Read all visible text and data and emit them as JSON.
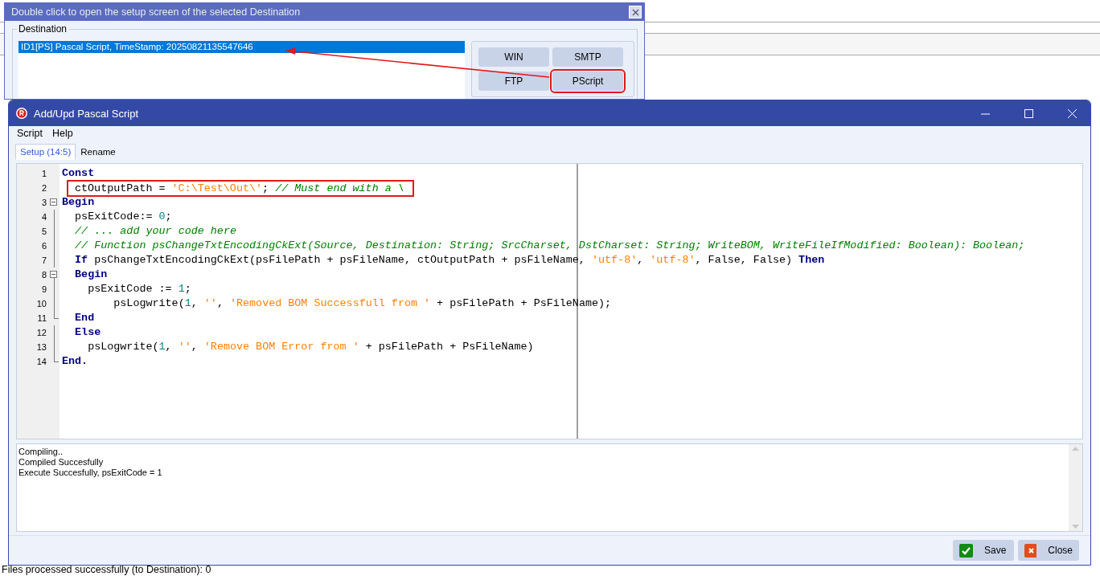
{
  "background": {
    "status_text": "Files processed successfully (to Destination): 0"
  },
  "destination_window": {
    "title": "Double click to open the setup screen of the selected Destination",
    "group_label": "Destination",
    "items": [
      {
        "text": "ID1[PS] Pascal Script, TimeStamp: 20250821135547646",
        "selected": true
      }
    ],
    "buttons": [
      {
        "label": "WIN",
        "highlighted": false
      },
      {
        "label": "SMTP",
        "highlighted": false
      },
      {
        "label": "FTP",
        "highlighted": false
      },
      {
        "label": "PScript",
        "highlighted": true
      }
    ]
  },
  "script_window": {
    "title": "Add/Upd Pascal Script",
    "menu": [
      "Script",
      "Help"
    ],
    "tabs": [
      {
        "label": "Setup (14:5)",
        "selected": true
      },
      {
        "label": "Rename",
        "selected": false
      }
    ],
    "code_lines": [
      {
        "number": "1",
        "kind": "plain",
        "highlighted": false,
        "tokens": [
          {
            "kind": "keyword",
            "text": "Const"
          }
        ]
      },
      {
        "number": "2",
        "kind": "plain",
        "highlighted": true,
        "tokens": [
          {
            "kind": "text",
            "text": "ctOutputPath = "
          },
          {
            "kind": "string",
            "text": "'C:\\Test\\Out\\'"
          },
          {
            "kind": "text",
            "text": "; "
          },
          {
            "kind": "comment",
            "text": "// Must end with a \\"
          }
        ]
      },
      {
        "number": "3",
        "kind": "opener",
        "highlighted": false,
        "tokens": [
          {
            "kind": "keyword",
            "text": "Begin"
          }
        ]
      },
      {
        "number": "4",
        "kind": "body",
        "highlighted": false,
        "tokens": [
          {
            "kind": "text",
            "text": "  psExitCode:= "
          },
          {
            "kind": "number",
            "text": "0"
          },
          {
            "kind": "text",
            "text": ";"
          }
        ]
      },
      {
        "number": "5",
        "kind": "body",
        "highlighted": false,
        "tokens": [
          {
            "kind": "comment",
            "text": "  // ... add your code here"
          }
        ]
      },
      {
        "number": "6",
        "kind": "body",
        "highlighted": false,
        "tokens": [
          {
            "kind": "comment",
            "text": "  // Function psChangeTxtEncodingCkExt(Source, Destination: String; SrcCharset, DstCharset: String; WriteBOM, WriteFileIfModified: Boolean): Boolean;"
          }
        ]
      },
      {
        "number": "7",
        "kind": "body",
        "highlighted": false,
        "tokens": [
          {
            "kind": "keyword",
            "text": "  If"
          },
          {
            "kind": "text",
            "text": " psChangeTxtEncodingCkExt(psFilePath + psFileName, ctOutputPath + psFileName, "
          },
          {
            "kind": "string",
            "text": "'utf-8'"
          },
          {
            "kind": "text",
            "text": ", "
          },
          {
            "kind": "string",
            "text": "'utf-8'"
          },
          {
            "kind": "text",
            "text": ", False, False) "
          },
          {
            "kind": "keyword",
            "text": "Then"
          }
        ]
      },
      {
        "number": "8",
        "kind": "opener",
        "highlighted": false,
        "tokens": [
          {
            "kind": "keyword",
            "text": "  Begin"
          }
        ]
      },
      {
        "number": "9",
        "kind": "body",
        "highlighted": false,
        "tokens": [
          {
            "kind": "text",
            "text": "    psExitCode := "
          },
          {
            "kind": "number",
            "text": "1"
          },
          {
            "kind": "text",
            "text": ";"
          }
        ]
      },
      {
        "number": "10",
        "kind": "body",
        "highlighted": false,
        "tokens": [
          {
            "kind": "text",
            "text": "        psLogwrite("
          },
          {
            "kind": "number",
            "text": "1"
          },
          {
            "kind": "text",
            "text": ", "
          },
          {
            "kind": "string",
            "text": "''"
          },
          {
            "kind": "text",
            "text": ", "
          },
          {
            "kind": "string",
            "text": "'Removed BOM Successfull from '"
          },
          {
            "kind": "text",
            "text": " + psFilePath + PsFileName);"
          }
        ]
      },
      {
        "number": "11",
        "kind": "closer",
        "highlighted": false,
        "tokens": [
          {
            "kind": "keyword",
            "text": "  End"
          }
        ]
      },
      {
        "number": "12",
        "kind": "body",
        "highlighted": false,
        "tokens": [
          {
            "kind": "keyword",
            "text": "  Else"
          }
        ]
      },
      {
        "number": "13",
        "kind": "body",
        "highlighted": false,
        "tokens": [
          {
            "kind": "text",
            "text": "    psLogwrite("
          },
          {
            "kind": "number",
            "text": "1"
          },
          {
            "kind": "text",
            "text": ", "
          },
          {
            "kind": "string",
            "text": "''"
          },
          {
            "kind": "text",
            "text": ", "
          },
          {
            "kind": "string",
            "text": "'Remove BOM Error from '"
          },
          {
            "kind": "text",
            "text": " + psFilePath + PsFileName)"
          }
        ]
      },
      {
        "number": "14",
        "kind": "closer",
        "highlighted": false,
        "tokens": [
          {
            "kind": "keyword",
            "text": "End."
          }
        ]
      }
    ],
    "log_lines": [
      "Compiling..",
      "Compiled Succesfully",
      "Execute Succesfully, psExitCode = 1"
    ],
    "buttons": [
      {
        "label": "Save",
        "kind": "save"
      },
      {
        "label": "Close",
        "kind": "close"
      }
    ]
  }
}
